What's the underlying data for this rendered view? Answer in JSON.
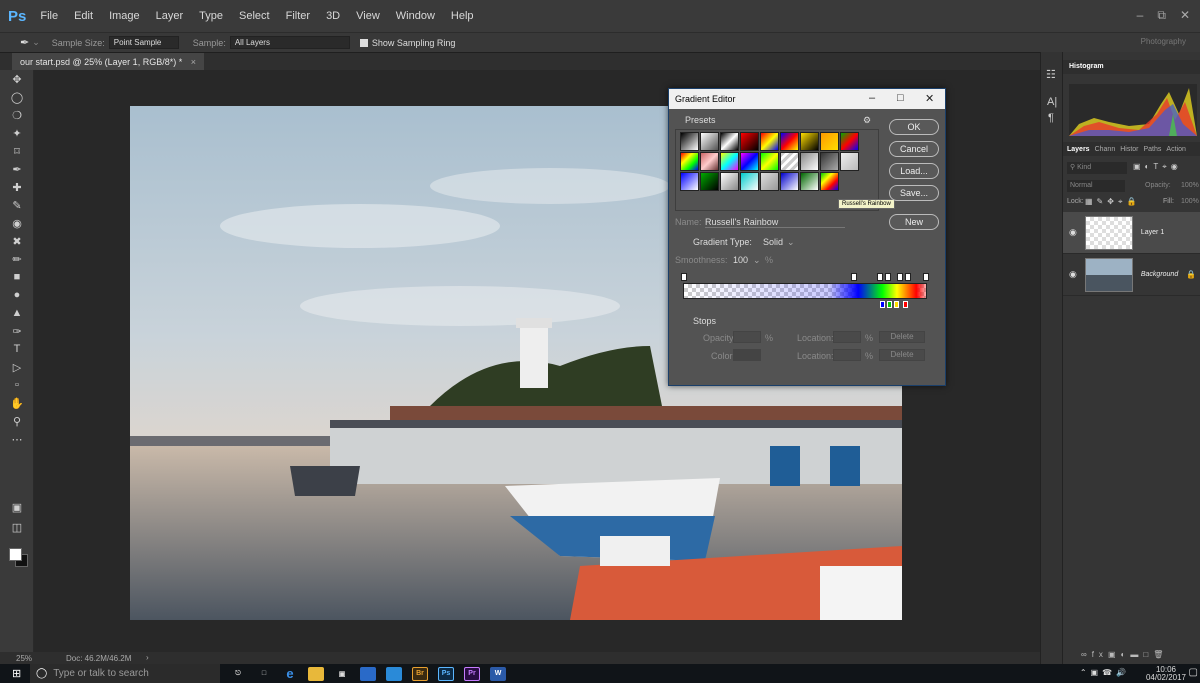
{
  "app": {
    "logo": "Ps"
  },
  "menu": [
    "File",
    "Edit",
    "Image",
    "Layer",
    "Type",
    "Select",
    "Filter",
    "3D",
    "View",
    "Window",
    "Help"
  ],
  "options": {
    "sample_size_label": "Sample Size:",
    "sample_size_value": "Point Sample",
    "sample_label": "Sample:",
    "sample_value": "All Layers",
    "show_ring_label": "Show Sampling Ring",
    "workspace": "Photography"
  },
  "document": {
    "tab_title": "our start.psd @ 25% (Layer 1, RGB/8*) *"
  },
  "status": {
    "zoom": "25%",
    "doc_size": "Doc: 46.2M/46.2M"
  },
  "gradient_editor": {
    "title": "Gradient Editor",
    "presets_label": "Presets",
    "tooltip": "Russell's Rainbow",
    "buttons": {
      "ok": "OK",
      "cancel": "Cancel",
      "load": "Load...",
      "save": "Save...",
      "new": "New"
    },
    "name_label": "Name:",
    "name_value": "Russell's Rainbow",
    "gradient_type_label": "Gradient Type:",
    "gradient_type_value": "Solid",
    "smoothness_label": "Smoothness:",
    "smoothness_value": "100",
    "percent": "%",
    "stops_label": "Stops",
    "opacity_label": "Opacity:",
    "color_label": "Color:",
    "location_label": "Location:",
    "delete_label": "Delete"
  },
  "panels": {
    "histogram_tab": "Histogram",
    "tabs": [
      "Layers",
      "Chann",
      "Histor",
      "Paths",
      "Action"
    ],
    "kind_label": "Kind",
    "blend_mode": "Normal",
    "opacity_label": "Opacity:",
    "opacity_value": "100%",
    "lock_label": "Lock:",
    "fill_label": "Fill:",
    "fill_value": "100%",
    "layers": [
      {
        "name": "Layer 1"
      },
      {
        "name": "Background"
      }
    ]
  },
  "taskbar": {
    "search_placeholder": "Type or talk to search",
    "time": "10:06",
    "date": "04/02/2017"
  }
}
